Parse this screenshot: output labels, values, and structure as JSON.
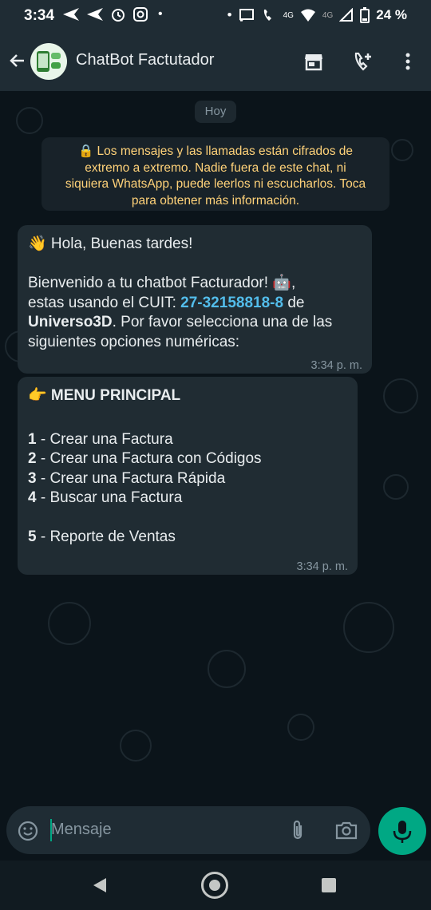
{
  "status_bar": {
    "time": "3:34",
    "left_icons": [
      "send-icon",
      "send-icon",
      "alarm-icon",
      "instagram-icon"
    ],
    "right_icons": [
      "cast-icon",
      "wifi-call-icon",
      "4g-label",
      "wifi-icon",
      "4g-label",
      "signal-icon",
      "battery-icon"
    ],
    "network_label_1": "4G",
    "network_label_2": "4G",
    "battery_percent": "24 %"
  },
  "header": {
    "title": "ChatBot Factutador",
    "icons": [
      "back-arrow-icon",
      "avatar",
      "storefront-icon",
      "add-call-icon",
      "more-vert-icon"
    ]
  },
  "chat": {
    "date_chip": "Hoy",
    "encryption_notice": {
      "line1": "🔒 Los mensajes y las llamadas están cifrados de",
      "line2": "extremo a extremo. Nadie fuera de este chat, ni",
      "line3": "siquiera WhatsApp, puede leerlos ni escucharlos. Toca",
      "line4": "para obtener más información."
    },
    "message1": {
      "greeting": "👋 Hola, Buenas tardes!",
      "welcome": "Bienvenido a tu chatbot Facturador! 🤖,",
      "cuit_prefix": "estas usando el CUIT: ",
      "cuit": "27-32158818-8",
      "cuit_suffix": " de",
      "company": "Universo3D",
      "line3_suffix": ". Por favor selecciona una de las",
      "line4": "siguientes opciones numéricas:",
      "time": "3:34 p. m."
    },
    "message2": {
      "title": "👉 MENU PRINCIPAL",
      "options": [
        {
          "number": "1",
          "text": " - Crear una Factura"
        },
        {
          "number": "2",
          "text": " - Crear una Factura con Códigos"
        },
        {
          "number": "3",
          "text": " - Crear una Factura Rápida"
        },
        {
          "number": "4",
          "text": " - Buscar una Factura"
        },
        {
          "number": "5",
          "text": " - Reporte de Ventas"
        }
      ],
      "time": "3:34 p. m."
    }
  },
  "composer": {
    "placeholder": "Mensaje",
    "icons": [
      "emoji-icon",
      "attach-icon",
      "camera-icon",
      "mic-icon"
    ]
  },
  "colors": {
    "header_bg": "#1f2c34",
    "chat_bg": "#0b141a",
    "bubble_bg": "#202c33",
    "accent_green": "#00a884",
    "link_blue": "#53bdeb",
    "encryption_text": "#ffd279"
  }
}
